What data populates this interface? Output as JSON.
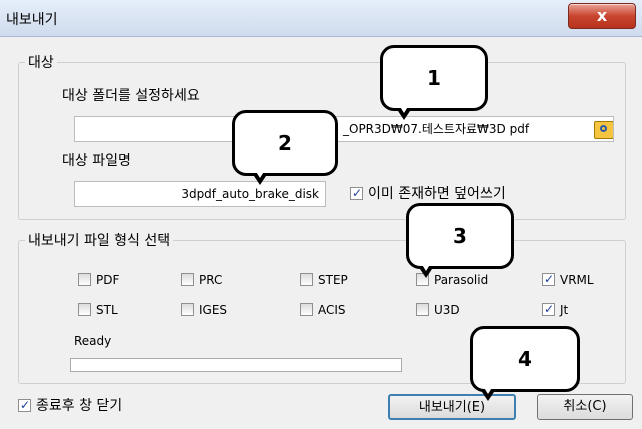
{
  "window": {
    "title": "내보내기",
    "close_symbol": "x"
  },
  "target": {
    "legend": "대상",
    "folder_label": "대상 폴더를 설정하세요",
    "folder_value": "_OPR3D₩07.테스트자료₩3D pdf",
    "file_label": "대상 파일명",
    "file_value": "3dpdf_auto_brake_disk",
    "overwrite_label": "이미 존재하면 덮어쓰기",
    "overwrite_checked": true
  },
  "formats": {
    "legend": "내보내기 파일 형식 선택",
    "items": [
      {
        "label": "PDF",
        "checked": false
      },
      {
        "label": "PRC",
        "checked": false
      },
      {
        "label": "STEP",
        "checked": false
      },
      {
        "label": "Parasolid",
        "checked": false
      },
      {
        "label": "VRML",
        "checked": true
      },
      {
        "label": "STL",
        "checked": false
      },
      {
        "label": "IGES",
        "checked": false
      },
      {
        "label": "ACIS",
        "checked": false
      },
      {
        "label": "U3D",
        "checked": false
      },
      {
        "label": "Jt",
        "checked": true
      }
    ],
    "status": "Ready",
    "progress": 0
  },
  "footer": {
    "close_after_label": "종료후 창 닫기",
    "close_after_checked": true,
    "export_button": "내보내기(E)",
    "cancel_button": "취소(C)"
  },
  "callouts": [
    "1",
    "2",
    "3",
    "4"
  ]
}
